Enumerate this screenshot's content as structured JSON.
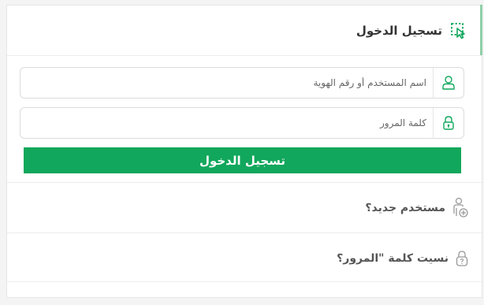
{
  "header": {
    "title": "تسجيل الدخول",
    "icon": "cursor-select-icon",
    "accent_color": "#11a75c"
  },
  "form": {
    "username_placeholder": "اسم المستخدم أو رقم الهوية",
    "password_placeholder": "كلمة المرور",
    "submit_label": "تسجيل الدخول"
  },
  "links": {
    "new_user": "مستخدم جديد؟",
    "forgot_password": "نسيت كلمة \"المرور؟"
  },
  "colors": {
    "primary": "#11a75c",
    "icon_gray": "#999999"
  }
}
